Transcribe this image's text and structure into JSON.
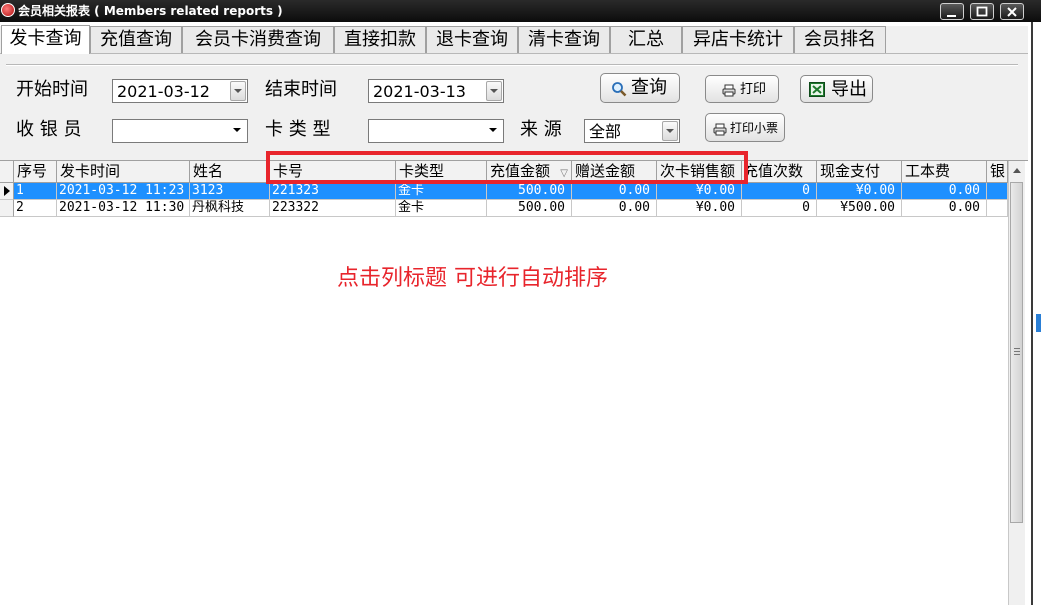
{
  "window": {
    "title": "会员相关报表 ( Members related reports )"
  },
  "tabs": [
    {
      "label": "发卡查询",
      "active": true
    },
    {
      "label": "充值查询",
      "active": false
    },
    {
      "label": "会员卡消费查询",
      "active": false
    },
    {
      "label": "直接扣款",
      "active": false
    },
    {
      "label": "退卡查询",
      "active": false
    },
    {
      "label": "清卡查询",
      "active": false
    },
    {
      "label": "汇总",
      "active": false
    },
    {
      "label": "异店卡统计",
      "active": false
    },
    {
      "label": "会员排名",
      "active": false
    }
  ],
  "filters": {
    "start_label": "开始时间",
    "start_value": "2021-03-12",
    "end_label": "结束时间",
    "end_value": "2021-03-13",
    "cashier_label": "收 银 员",
    "cashier_value": "",
    "card_type_label": "卡 类 型",
    "card_type_value": "",
    "source_label": "来 源",
    "source_value": "全部"
  },
  "buttons": {
    "query": "查询",
    "print": "打印",
    "export": "导出",
    "print_receipt": "打印小票"
  },
  "table": {
    "columns": [
      "序号",
      "发卡时间",
      "姓名",
      "卡号",
      "卡类型",
      "充值金额",
      "赠送金额",
      "次卡销售额",
      "充值次数",
      "现金支付",
      "工本费",
      "银"
    ],
    "sorted_column": "充值金额",
    "rows": [
      [
        "1",
        "2021-03-12 11:23",
        "3123",
        "221323",
        "金卡",
        "500.00",
        "0.00",
        "¥0.00",
        "0",
        "¥0.00",
        "0.00",
        ""
      ],
      [
        "2",
        "2021-03-12 11:30",
        "丹枫科技",
        "223322",
        "金卡",
        "500.00",
        "0.00",
        "¥0.00",
        "0",
        "¥500.00",
        "0.00",
        ""
      ]
    ],
    "selected_row": 0
  },
  "annotation": {
    "text": "点击列标题 可进行自动排序",
    "color": "#e8252c"
  },
  "colors": {
    "selection": "#1e90ff",
    "highlight_border": "#e8252c"
  }
}
